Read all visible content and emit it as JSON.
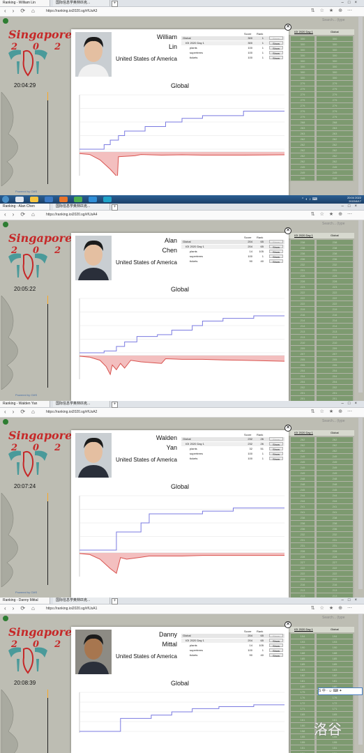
{
  "tabs": {
    "tab1_prefix": "Ranking -",
    "tab2": "国际信息学奥林匹克...",
    "newtab": "+"
  },
  "url": "https://ranking.ioi2020.sg/#/UsA",
  "contest": "IOI 2020 Day 1",
  "column_header": "Global",
  "columns": {
    "score": "Score",
    "rank": "Rank"
  },
  "show_label": "Show",
  "graph_title": "Global",
  "search_hint": "Search... (type",
  "logo": {
    "title": "Singapore",
    "year_left": "20",
    "year_right": "20"
  },
  "powered_by": "Powered by CMS",
  "taskbar": {
    "time": "20:04 2022",
    "date": "2022/8/17"
  },
  "watermark": "洛谷",
  "panels": [
    {
      "tab_name": "William Lin",
      "url": "https://ranking.ioi2020.sg/#/UsA3",
      "clock": "20:04:29",
      "first": "William",
      "last": "Lin",
      "country": "United States of America",
      "global": {
        "score": "300",
        "rank": "1"
      },
      "day": {
        "score": "300",
        "rank": "1"
      },
      "tasks": [
        {
          "name": "plants",
          "score": "100",
          "rank": "1"
        },
        {
          "name": "supertrees",
          "score": "100",
          "rank": "1"
        },
        {
          "name": "tickets",
          "score": "100",
          "rank": "1"
        }
      ],
      "right_rows": [
        [
          "300",
          "300"
        ],
        [
          "300",
          "300"
        ],
        [
          "300",
          "300"
        ],
        [
          "300",
          "300"
        ],
        [
          "300",
          "300"
        ],
        [
          "300",
          "300"
        ],
        [
          "300",
          "300"
        ],
        [
          "300",
          "300"
        ],
        [
          "279",
          "279"
        ],
        [
          "279",
          "279"
        ],
        [
          "279",
          "279"
        ],
        [
          "279",
          "279"
        ],
        [
          "279",
          "279"
        ],
        [
          "279",
          "279"
        ],
        [
          "279",
          "279"
        ],
        [
          "268",
          "268"
        ],
        [
          "263",
          "263"
        ],
        [
          "263",
          "263"
        ],
        [
          "262",
          "262"
        ],
        [
          "262",
          "262"
        ],
        [
          "262",
          "262"
        ],
        [
          "262",
          "262"
        ],
        [
          "262",
          "262"
        ],
        [
          "249",
          "249"
        ],
        [
          "249",
          "249"
        ],
        [
          "249",
          "249"
        ]
      ],
      "chart_data": {
        "type": "line",
        "series": [
          {
            "points": [
              [
                0,
                0
              ],
              [
                0.12,
                0
              ],
              [
                0.12,
                25
              ],
              [
                0.15,
                25
              ],
              [
                0.15,
                50
              ],
              [
                0.19,
                50
              ],
              [
                0.19,
                75
              ],
              [
                0.22,
                75
              ],
              [
                0.22,
                100
              ],
              [
                0.32,
                100
              ],
              [
                0.32,
                125
              ],
              [
                0.42,
                125
              ],
              [
                0.42,
                150
              ],
              [
                0.5,
                150
              ],
              [
                0.5,
                170
              ],
              [
                0.6,
                170
              ],
              [
                0.6,
                185
              ],
              [
                0.8,
                185
              ],
              [
                0.8,
                210
              ],
              [
                1,
                210
              ]
            ],
            "ylim": [
              0,
              300
            ]
          },
          {
            "points": [
              [
                0,
                5
              ],
              [
                0.05,
                8
              ],
              [
                0.1,
                25
              ],
              [
                0.15,
                55
              ],
              [
                0.185,
                80
              ],
              [
                0.19,
                15
              ],
              [
                0.22,
                14
              ],
              [
                0.27,
                12
              ],
              [
                0.3,
                8
              ],
              [
                0.4,
                10
              ],
              [
                0.5,
                9
              ],
              [
                0.6,
                10
              ],
              [
                0.7,
                10
              ],
              [
                0.8,
                10
              ],
              [
                1,
                9
              ]
            ]
          }
        ]
      }
    },
    {
      "tab_name": "Alan Chen",
      "url": "https://ranking.ioi2020.sg/#/UsA4",
      "clock": "20:05:22",
      "first": "Alan",
      "last": "Chen",
      "country": "United States of America",
      "global": {
        "score": "204",
        "rank": "65"
      },
      "day": {
        "score": "204",
        "rank": "65"
      },
      "tasks": [
        {
          "name": "plants",
          "score": "14",
          "rank": "105"
        },
        {
          "name": "supertrees",
          "score": "100",
          "rank": "1"
        },
        {
          "name": "tickets",
          "score": "90",
          "rank": "40"
        }
      ],
      "right_rows": [
        [
          "238",
          "238"
        ],
        [
          "238",
          "238"
        ],
        [
          "238",
          "238"
        ],
        [
          "236",
          "236"
        ],
        [
          "232",
          "232"
        ],
        [
          "231",
          "231"
        ],
        [
          "228",
          "228"
        ],
        [
          "228",
          "228"
        ],
        [
          "223",
          "223"
        ],
        [
          "222",
          "222"
        ],
        [
          "222",
          "222"
        ],
        [
          "222",
          "222"
        ],
        [
          "219",
          "219"
        ],
        [
          "216",
          "216"
        ],
        [
          "214",
          "214"
        ],
        [
          "214",
          "214"
        ],
        [
          "213",
          "213"
        ],
        [
          "213",
          "213"
        ],
        [
          "210",
          "210"
        ],
        [
          "209",
          "209"
        ],
        [
          "207",
          "207"
        ],
        [
          "205",
          "205"
        ],
        [
          "205",
          "205"
        ],
        [
          "204",
          "204"
        ],
        [
          "204",
          "204"
        ],
        [
          "204",
          "204"
        ],
        [
          "202",
          "202"
        ],
        [
          "201",
          "201"
        ],
        [
          "201",
          "201"
        ]
      ],
      "chart_data": {
        "type": "line",
        "series": [
          {
            "points": [
              [
                0,
                0
              ],
              [
                0.12,
                0
              ],
              [
                0.12,
                10
              ],
              [
                0.18,
                10
              ],
              [
                0.18,
                35
              ],
              [
                0.22,
                35
              ],
              [
                0.22,
                60
              ],
              [
                0.28,
                60
              ],
              [
                0.28,
                90
              ],
              [
                0.38,
                90
              ],
              [
                0.38,
                100
              ],
              [
                0.45,
                100
              ],
              [
                0.45,
                125
              ],
              [
                0.55,
                125
              ],
              [
                0.55,
                150
              ],
              [
                0.6,
                150
              ],
              [
                0.6,
                175
              ],
              [
                0.7,
                175
              ],
              [
                0.7,
                190
              ],
              [
                0.85,
                190
              ],
              [
                0.85,
                204
              ],
              [
                1,
                204
              ]
            ],
            "ylim": [
              0,
              300
            ]
          },
          {
            "points": [
              [
                0,
                2
              ],
              [
                0.05,
                5
              ],
              [
                0.1,
                15
              ],
              [
                0.13,
                35
              ],
              [
                0.15,
                60
              ],
              [
                0.16,
                30
              ],
              [
                0.18,
                45
              ],
              [
                0.2,
                25
              ],
              [
                0.22,
                40
              ],
              [
                0.25,
                15
              ],
              [
                0.3,
                20
              ],
              [
                0.4,
                25
              ],
              [
                0.42,
                10
              ],
              [
                0.5,
                12
              ],
              [
                0.6,
                12
              ],
              [
                0.7,
                14
              ],
              [
                0.8,
                15
              ],
              [
                1,
                18
              ]
            ]
          }
        ]
      }
    },
    {
      "tab_name": "Walden Yan",
      "url": "https://ranking.ioi2020.sg/#/UsA2",
      "clock": "20:07:24",
      "first": "Walden",
      "last": "Yan",
      "country": "United States of America",
      "global": {
        "score": "232",
        "rank": "26"
      },
      "day": {
        "score": "232",
        "rank": "26"
      },
      "tasks": [
        {
          "name": "plants",
          "score": "32",
          "rank": "51"
        },
        {
          "name": "supertrees",
          "score": "100",
          "rank": "1"
        },
        {
          "name": "tickets",
          "score": "100",
          "rank": "1"
        }
      ],
      "right_rows": [
        [
          "262",
          "262"
        ],
        [
          "262",
          "262"
        ],
        [
          "262",
          "262"
        ],
        [
          "249",
          "249"
        ],
        [
          "249",
          "249"
        ],
        [
          "249",
          "249"
        ],
        [
          "249",
          "249"
        ],
        [
          "248",
          "248"
        ],
        [
          "248",
          "248"
        ],
        [
          "245",
          "245"
        ],
        [
          "244",
          "244"
        ],
        [
          "244",
          "244"
        ],
        [
          "241",
          "241"
        ],
        [
          "241",
          "241"
        ],
        [
          "238",
          "238"
        ],
        [
          "238",
          "238"
        ],
        [
          "236",
          "236"
        ],
        [
          "232",
          "232"
        ],
        [
          "231",
          "231"
        ],
        [
          "231",
          "231"
        ],
        [
          "228",
          "228"
        ],
        [
          "228",
          "228"
        ],
        [
          "227",
          "227"
        ],
        [
          "222",
          "222"
        ],
        [
          "222",
          "222"
        ],
        [
          "219",
          "219"
        ],
        [
          "216",
          "216"
        ],
        [
          "213",
          "213"
        ],
        [
          "213",
          "213"
        ],
        [
          "213",
          "213"
        ]
      ],
      "chart_data": {
        "type": "line",
        "series": [
          {
            "points": [
              [
                0,
                0
              ],
              [
                0.18,
                0
              ],
              [
                0.18,
                100
              ],
              [
                0.3,
                100
              ],
              [
                0.3,
                150
              ],
              [
                0.34,
                150
              ],
              [
                0.34,
                200
              ],
              [
                0.6,
                200
              ],
              [
                0.6,
                215
              ],
              [
                0.75,
                215
              ],
              [
                0.75,
                232
              ],
              [
                1,
                232
              ]
            ],
            "ylim": [
              0,
              300
            ]
          },
          {
            "points": [
              [
                0,
                2
              ],
              [
                0.05,
                5
              ],
              [
                0.1,
                20
              ],
              [
                0.15,
                50
              ],
              [
                0.18,
                65
              ],
              [
                0.2,
                15
              ],
              [
                0.23,
                20
              ],
              [
                0.3,
                14
              ],
              [
                0.34,
                10
              ],
              [
                0.5,
                10
              ],
              [
                0.6,
                8
              ],
              [
                0.75,
                8
              ],
              [
                1,
                8
              ]
            ]
          }
        ]
      }
    },
    {
      "tab_name": "Danny Mittal",
      "url": "https://ranking.ioi2020.sg/#/UsA1",
      "clock": "20:08:39",
      "first": "Danny",
      "last": "Mittal",
      "country": "United States of America",
      "global": {
        "score": "204",
        "rank": "65"
      },
      "day": {
        "score": "204",
        "rank": "65"
      },
      "tasks": [
        {
          "name": "plants",
          "score": "14",
          "rank": "105"
        },
        {
          "name": "supertrees",
          "score": "100",
          "rank": "1"
        },
        {
          "name": "tickets",
          "score": "90",
          "rank": "40"
        }
      ],
      "right_rows": [
        [
          "194",
          "194"
        ],
        [
          "193",
          "193"
        ],
        [
          "190",
          "190"
        ],
        [
          "188",
          "188"
        ],
        [
          "185",
          "185"
        ],
        [
          "185",
          "185"
        ],
        [
          "183",
          "183"
        ],
        [
          "182",
          "182"
        ],
        [
          "181",
          "181"
        ],
        [
          "180",
          "180"
        ],
        [
          "179",
          "179"
        ],
        [
          "176",
          "176"
        ],
        [
          "172",
          "172"
        ],
        [
          "171",
          "171"
        ],
        [
          "165",
          "165"
        ],
        [
          "161",
          "161"
        ],
        [
          "160",
          "160"
        ],
        [
          "158",
          "158"
        ],
        [
          "155",
          "155"
        ],
        [
          "155",
          "155"
        ],
        [
          "151",
          "151"
        ],
        [
          "151",
          "151"
        ]
      ],
      "chart_data": {
        "type": "line",
        "series": [
          {
            "points": [
              [
                0,
                0
              ],
              [
                0.2,
                0
              ],
              [
                0.2,
                100
              ],
              [
                0.35,
                100
              ],
              [
                0.35,
                125
              ],
              [
                0.45,
                125
              ],
              [
                0.45,
                150
              ],
              [
                0.55,
                150
              ],
              [
                0.55,
                175
              ],
              [
                0.68,
                175
              ],
              [
                0.68,
                190
              ],
              [
                0.85,
                190
              ],
              [
                0.85,
                204
              ],
              [
                1,
                204
              ]
            ],
            "ylim": [
              0,
              300
            ]
          }
        ]
      }
    }
  ]
}
